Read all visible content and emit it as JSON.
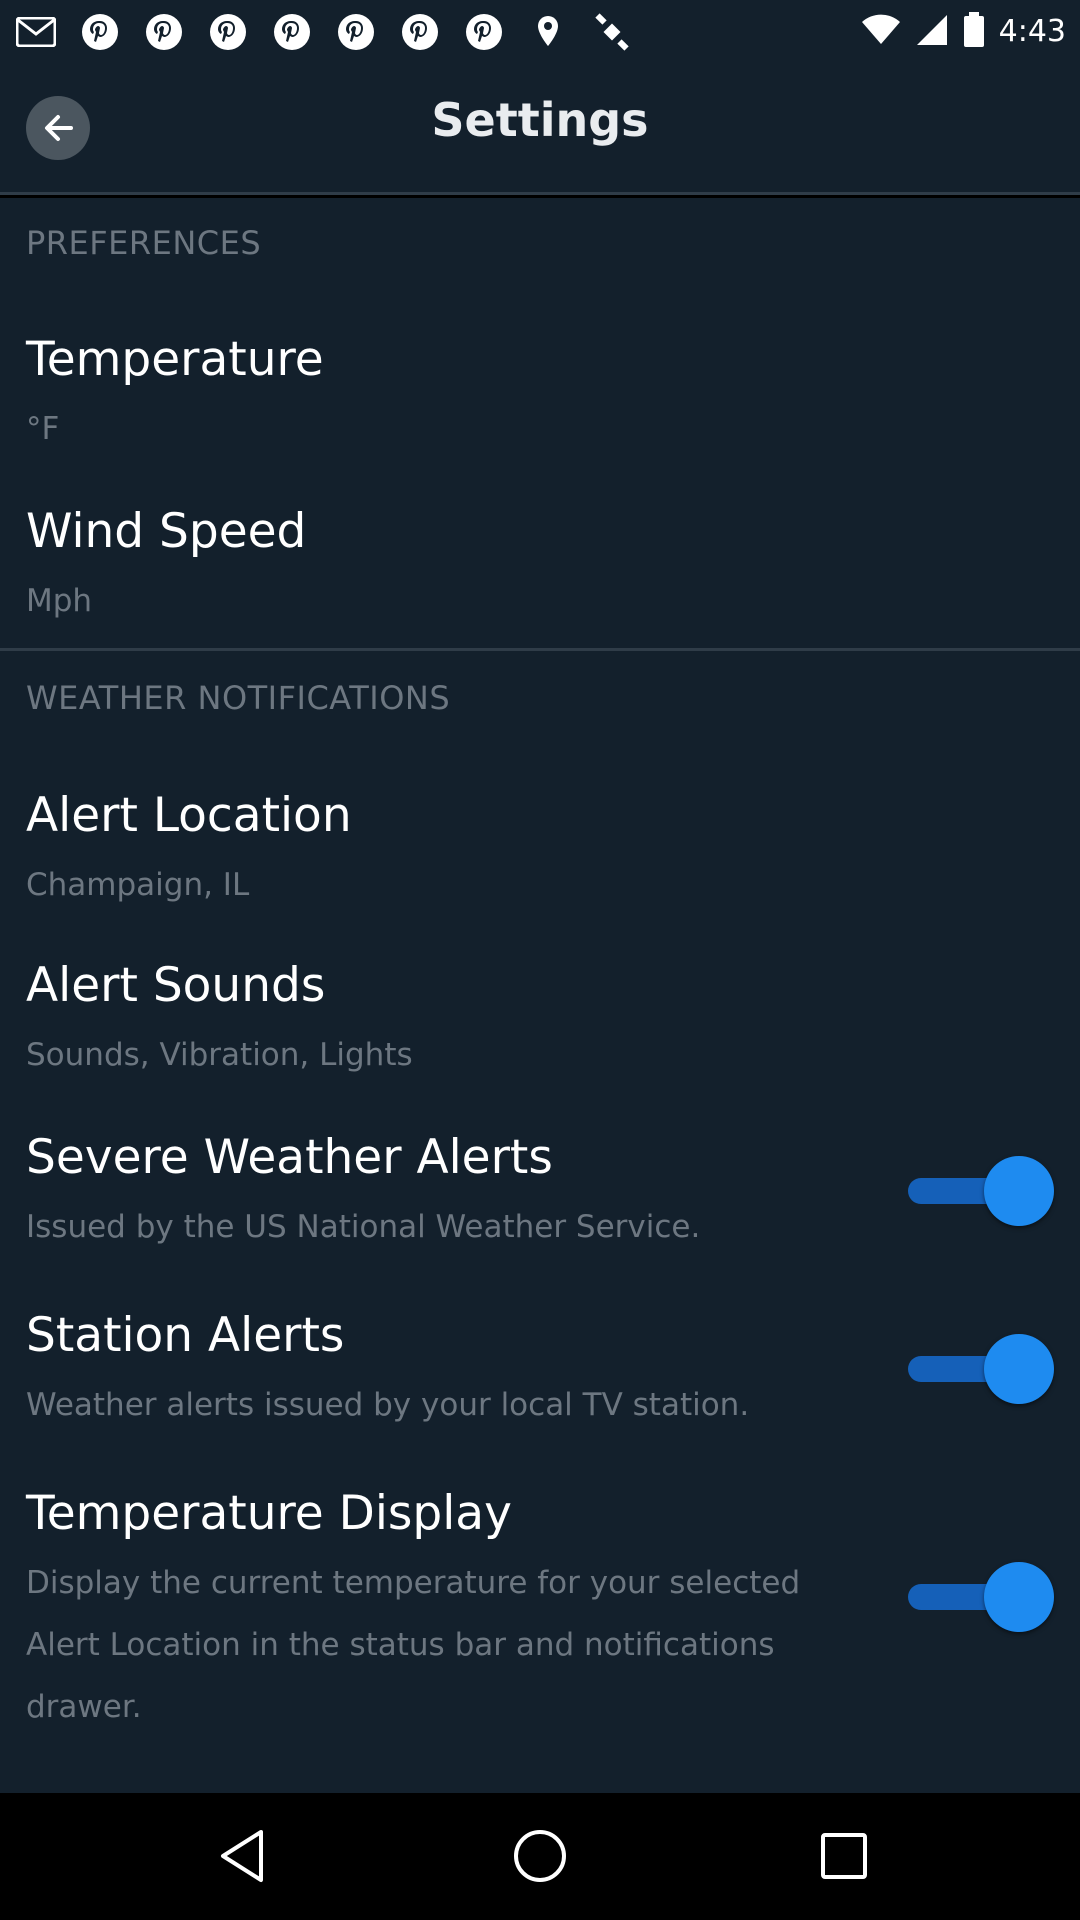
{
  "status_bar": {
    "time": "4:43",
    "icons": [
      "gmail-icon",
      "pinterest-icon",
      "pinterest-icon",
      "pinterest-icon",
      "pinterest-icon",
      "pinterest-icon",
      "pinterest-icon",
      "fake-gps-icon",
      "satellite-icon"
    ]
  },
  "header": {
    "title": "Settings",
    "back_icon": "arrow-left-icon"
  },
  "preferences": {
    "header": "PREFERENCES",
    "items": [
      {
        "title": "Temperature",
        "subtitle": "°F"
      },
      {
        "title": "Wind Speed",
        "subtitle": "Mph"
      }
    ]
  },
  "weather_notifications": {
    "header": "WEATHER NOTIFICATIONS",
    "items": [
      {
        "title": "Alert Location",
        "subtitle": "Champaign, IL"
      },
      {
        "title": "Alert Sounds",
        "subtitle": "Sounds, Vibration, Lights"
      },
      {
        "title": "Severe Weather Alerts",
        "subtitle": "Issued by the US National Weather Service.",
        "toggle": true
      },
      {
        "title": "Station Alerts",
        "subtitle": "Weather alerts issued by your local TV station.",
        "toggle": true
      },
      {
        "title": "Temperature Display",
        "subtitle_lines": [
          "Display the current temperature for your selected",
          "Alert Location in the status bar and notifications",
          "drawer."
        ],
        "toggle": true
      }
    ]
  },
  "colors": {
    "background": "#13202c",
    "accent": "#1e8bf0",
    "secondary_text": "#6d7781"
  },
  "nav": {
    "back": "nav-back-icon",
    "home": "nav-home-icon",
    "recents": "nav-recents-icon"
  }
}
